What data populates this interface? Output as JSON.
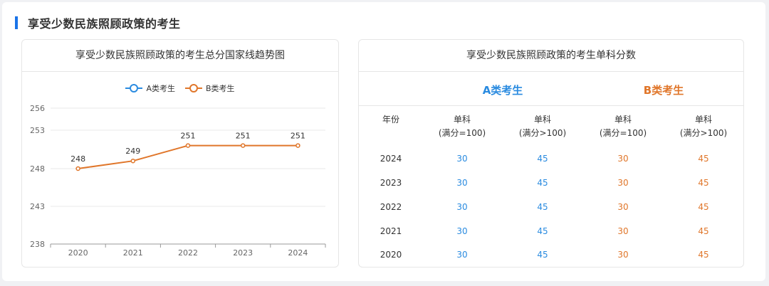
{
  "section_title": "享受少数民族照顾政策的考生",
  "left_card": {
    "title": "享受少数民族照顾政策的考生总分国家线趋势图",
    "legend": [
      {
        "label": "A类考生",
        "color": "#2a8be0"
      },
      {
        "label": "B类考生",
        "color": "#e0762a"
      }
    ]
  },
  "chart_data": {
    "type": "line",
    "categories": [
      "2020",
      "2021",
      "2022",
      "2023",
      "2024"
    ],
    "series": [
      {
        "name": "B类考生",
        "values": [
          248,
          249,
          251,
          251,
          251
        ],
        "color": "#e0762a"
      }
    ],
    "y_ticks": [
      256,
      253,
      248,
      243,
      238
    ],
    "ylim": [
      238,
      256
    ],
    "grid": true,
    "legend_position": "top"
  },
  "right_card": {
    "title": "享受少数民族照顾政策的考生单科分数",
    "group_a": "A类考生",
    "group_b": "B类考生",
    "color_a": "#2a8be0",
    "color_b": "#e0762a",
    "year_header": "年份",
    "columns": [
      {
        "line1": "单科",
        "line2": "(满分=100)"
      },
      {
        "line1": "单科",
        "line2": "(满分>100)"
      },
      {
        "line1": "单科",
        "line2": "(满分=100)"
      },
      {
        "line1": "单科",
        "line2": "(满分>100)"
      }
    ],
    "rows": [
      {
        "year": "2024",
        "values": [
          "30",
          "45",
          "30",
          "45"
        ]
      },
      {
        "year": "2023",
        "values": [
          "30",
          "45",
          "30",
          "45"
        ]
      },
      {
        "year": "2022",
        "values": [
          "30",
          "45",
          "30",
          "45"
        ]
      },
      {
        "year": "2021",
        "values": [
          "30",
          "45",
          "30",
          "45"
        ]
      },
      {
        "year": "2020",
        "values": [
          "30",
          "45",
          "30",
          "45"
        ]
      }
    ]
  }
}
